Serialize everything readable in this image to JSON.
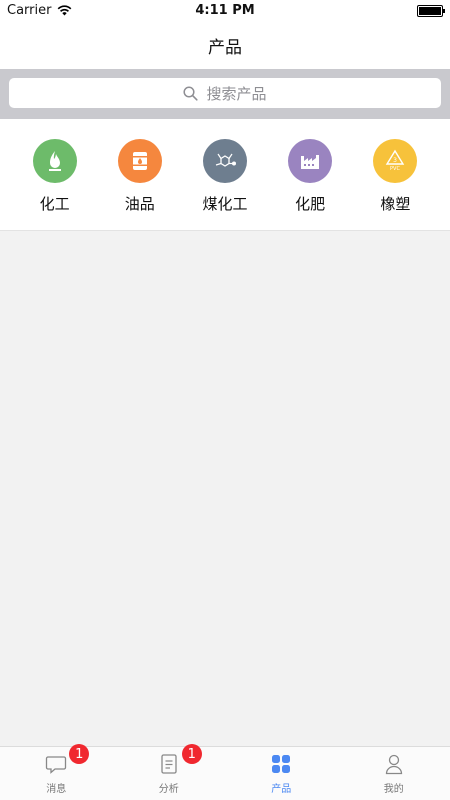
{
  "status_bar": {
    "carrier": "Carrier",
    "time": "4:11 PM",
    "battery_level": 1.0
  },
  "nav": {
    "title": "产品"
  },
  "search": {
    "placeholder": "搜索产品"
  },
  "categories": [
    {
      "label": "化工",
      "icon": "flame-icon",
      "color": "#6dbb6a"
    },
    {
      "label": "油品",
      "icon": "oil-barrel-icon",
      "color": "#f5873e"
    },
    {
      "label": "煤化工",
      "icon": "molecule-icon",
      "color": "#6e7e8f"
    },
    {
      "label": "化肥",
      "icon": "factory-icon",
      "color": "#9a84c0"
    },
    {
      "label": "橡塑",
      "icon": "pvc-recycle-icon",
      "color": "#f7c23b"
    }
  ],
  "tabs": [
    {
      "label": "消息",
      "icon": "message-icon",
      "badge": "1"
    },
    {
      "label": "分析",
      "icon": "document-icon",
      "badge": "1"
    },
    {
      "label": "产品",
      "icon": "grid-icon",
      "active": true
    },
    {
      "label": "我的",
      "icon": "user-icon"
    }
  ],
  "colors": {
    "accent": "#4b88f2",
    "badge": "#f0282f"
  }
}
